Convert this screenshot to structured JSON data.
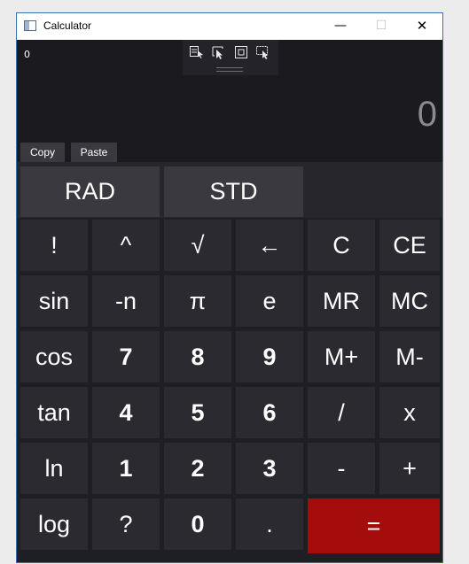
{
  "window": {
    "title": "Calculator",
    "minimize_glyph": "—",
    "maximize_glyph": "☐",
    "close_glyph": "✕"
  },
  "display": {
    "expression": "0",
    "result": "0",
    "copy_label": "Copy",
    "paste_label": "Paste"
  },
  "toolbar": {
    "icons": [
      "select-element-icon",
      "pointer-select-icon",
      "frame-icon",
      "track-focus-icon"
    ]
  },
  "modes": {
    "angle": "RAD",
    "view": "STD"
  },
  "keys": [
    [
      "!",
      "^",
      "√",
      "←",
      "C",
      "CE"
    ],
    [
      "sin",
      "-n",
      "π",
      "e",
      "MR",
      "MC"
    ],
    [
      "cos",
      "7",
      "8",
      "9",
      "M+",
      "M-"
    ],
    [
      "tan",
      "4",
      "5",
      "6",
      "/",
      "x"
    ],
    [
      "ln",
      "1",
      "2",
      "3",
      "-",
      "+"
    ],
    [
      "log",
      "?",
      "0",
      ".",
      "="
    ]
  ],
  "colors": {
    "equals_button": "#a50d0c",
    "key_background": "#2b2a30",
    "window_border": "#3b6fb3"
  }
}
